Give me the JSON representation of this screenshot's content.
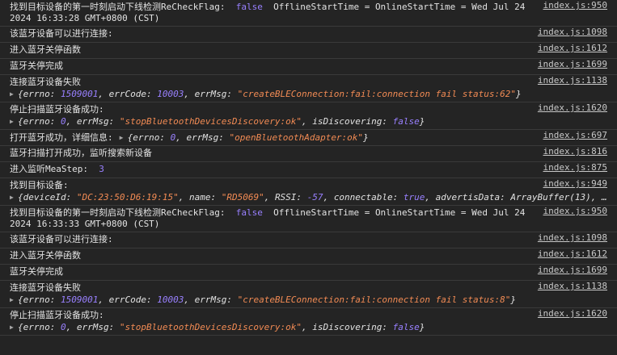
{
  "colors": {
    "background": "#242424",
    "text": "#e3e3e3",
    "number": "#9980ff",
    "string": "#f28b54",
    "boolean": "#9980ff",
    "divider": "#3a3a3a"
  },
  "icons": {
    "expand": "expand-triangle-icon"
  },
  "entries": [
    {
      "msg_a": "找到目标设备的第一时刻启动下线检测ReCheckFlag:",
      "bool": "false",
      "msg_b": "OfflineStartTime = OnlineStartTime = Wed Jul 24 2024 16:33:28 GMT+0800 (CST)",
      "src": "index.js:950"
    },
    {
      "msg": "该蓝牙设备可以进行连接:",
      "src": "index.js:1098"
    },
    {
      "msg": "进入蓝牙关停函数",
      "src": "index.js:1612"
    },
    {
      "msg": "蓝牙关停完成",
      "src": "index.js:1699"
    },
    {
      "msg": "连接蓝牙设备失败",
      "src": "index.js:1138",
      "obj": {
        "errno_key": "errno:",
        "errno": "1509001",
        "errCode_key": "errCode:",
        "errCode": "10003",
        "errMsg_key": "errMsg:",
        "errMsg": "\"createBLEConnection:fail:connection fail status:62\""
      }
    },
    {
      "msg": "停止扫描蓝牙设备成功:",
      "src": "index.js:1620",
      "obj": {
        "errno_key": "errno:",
        "errno": "0",
        "errMsg_key": "errMsg:",
        "errMsg": "\"stopBluetoothDevicesDiscovery:ok\"",
        "isDiscovering_key": "isDiscovering:",
        "isDiscovering": "false"
      }
    },
    {
      "msg": "打开蓝牙成功，详细信息:",
      "src": "index.js:697",
      "obj": {
        "errno_key": "errno:",
        "errno": "0",
        "errMsg_key": "errMsg:",
        "errMsg": "\"openBluetoothAdapter:ok\""
      }
    },
    {
      "msg": "蓝牙扫描打开成功，监听搜索新设备",
      "src": "index.js:816"
    },
    {
      "msg": "进入监听MeaStep:",
      "num": "3",
      "src": "index.js:875"
    },
    {
      "msg": "找到目标设备:",
      "src": "index.js:949",
      "obj": {
        "deviceId_key": "deviceId:",
        "deviceId": "\"DC:23:50:D6:19:15\"",
        "name_key": "name:",
        "name": "\"RD5069\"",
        "RSSI_key": "RSSI:",
        "RSSI": "-57",
        "connectable_key": "connectable:",
        "connectable": "true",
        "advertisData_key": "advertisData:",
        "advertisData": "ArrayBuffer(13), …"
      }
    },
    {
      "msg_a": "找到目标设备的第一时刻启动下线检测ReCheckFlag:",
      "bool": "false",
      "msg_b": "OfflineStartTime = OnlineStartTime = Wed Jul 24 2024 16:33:33 GMT+0800 (CST)",
      "src": "index.js:950"
    },
    {
      "msg": "该蓝牙设备可以进行连接:",
      "src": "index.js:1098"
    },
    {
      "msg": "进入蓝牙关停函数",
      "src": "index.js:1612"
    },
    {
      "msg": "蓝牙关停完成",
      "src": "index.js:1699"
    },
    {
      "msg": "连接蓝牙设备失败",
      "src": "index.js:1138",
      "obj": {
        "errno_key": "errno:",
        "errno": "1509001",
        "errCode_key": "errCode:",
        "errCode": "10003",
        "errMsg_key": "errMsg:",
        "errMsg": "\"createBLEConnection:fail:connection fail status:8\""
      }
    },
    {
      "msg": "停止扫描蓝牙设备成功:",
      "src": "index.js:1620",
      "obj": {
        "errno_key": "errno:",
        "errno": "0",
        "errMsg_key": "errMsg:",
        "errMsg": "\"stopBluetoothDevicesDiscovery:ok\"",
        "isDiscovering_key": "isDiscovering:",
        "isDiscovering": "false"
      }
    }
  ]
}
